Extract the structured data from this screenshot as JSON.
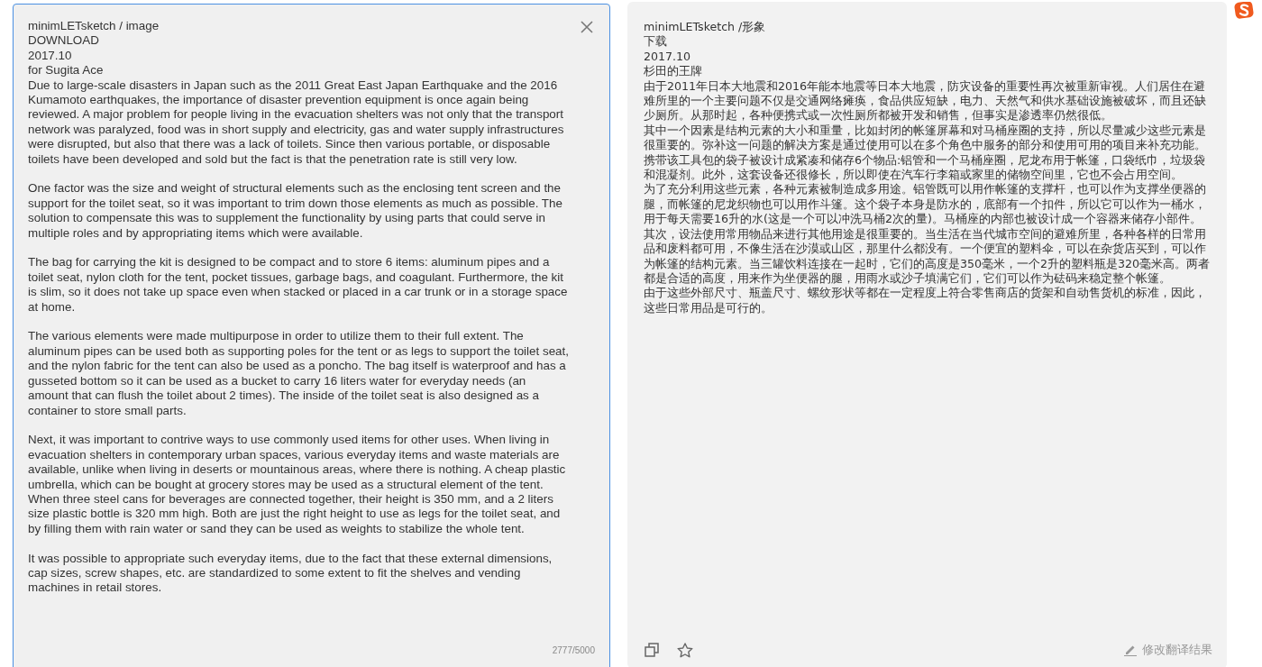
{
  "source": {
    "header": [
      "minimLETsketch / image",
      "DOWNLOAD",
      "2017.10",
      "for Sugita Ace"
    ],
    "paragraphs": [
      "Due to large-scale disasters in Japan such as the 2011 Great East Japan Earthquake and the 2016 Kumamoto earthquakes, the importance of disaster prevention equipment is once again being reviewed. A major problem for people living in the evacuation shelters was not only that the transport network was paralyzed, food was in short supply and electricity, gas and water supply infrastructures were disrupted, but also that there was a lack of toilets. Since then various portable, or disposable toilets have been developed and sold but the fact is that the penetration rate is still very low.",
      "One factor was the size and weight of structural elements such as the enclosing tent screen and the support for the toilet seat, so it was important to trim down those elements as much as possible. The solution to compensate this was to supplement the functionality by using parts that could serve in multiple roles and by appropriating items which were available.",
      "The bag for carrying the kit is designed to be compact and to store 6 items: aluminum pipes and a toilet seat, nylon cloth for the tent, pocket tissues, garbage bags, and coagulant. Furthermore, the kit is slim, so it does not take up space even when stacked or placed in a car trunk or in a storage space at home.",
      "The various elements were made multipurpose in order to utilize them to their full extent. The aluminum pipes can be used both as supporting poles for the tent or as legs to support the toilet seat, and the nylon fabric for the tent can also be used as a poncho. The bag itself is waterproof and has a gusseted bottom so it can be used as a bucket to carry 16 liters water for everyday needs (an amount that can flush the toilet about 2 times). The inside of the toilet seat is also designed as a container to store small parts.",
      "Next, it was important to contrive ways to use commonly used items for other uses. When living in evacuation shelters in contemporary urban spaces, various everyday items and waste materials are available, unlike when living in deserts or mountainous areas, where there is nothing. A cheap plastic umbrella, which can be bought at grocery stores may be used as a structural element of the tent. When three steel cans for beverages are connected together, their height is 350 mm, and a 2 liters size plastic bottle is 320 mm high. Both are just the right height to use as legs for the toilet seat, and by filling them with rain water or sand they can be used as weights to stabilize the whole tent.",
      "It was possible to appropriate such everyday items, due to the fact that these external dimensions, cap sizes, screw shapes, etc. are standardized to some extent to fit the shelves and vending machines in retail stores."
    ],
    "char_count": "2777/5000"
  },
  "translation": {
    "header": [
      "minimLETsketch /形象",
      "下载",
      "2017.10",
      "杉田的王牌"
    ],
    "paragraphs": [
      "由于2011年日本大地震和2016年能本地震等日本大地震，防灾设备的重要性再次被重新审视。人们居住在避难所里的一个主要问题不仅是交通网络瘫痪，食品供应短缺，电力、天然气和供水基础设施被破坏，而且还缺少厕所。从那时起，各种便携式或一次性厕所都被开发和销售，但事实是渗透率仍然很低。",
      "其中一个因素是结构元素的大小和重量，比如封闭的帐篷屏幕和对马桶座圈的支持，所以尽量减少这些元素是很重要的。弥补这一问题的解决方案是通过使用可以在多个角色中服务的部分和使用可用的项目来补充功能。",
      "携带该工具包的袋子被设计成紧凑和储存6个物品:铝管和一个马桶座圈，尼龙布用于帐篷，口袋纸巾，垃圾袋和混凝剂。此外，这套设备还很修长，所以即使在汽车行李箱或家里的储物空间里，它也不会占用空间。",
      "为了充分利用这些元素，各种元素被制造成多用途。铝管既可以用作帐篷的支撑杆，也可以作为支撑坐便器的腿，而帐篷的尼龙织物也可以用作斗篷。这个袋子本身是防水的，底部有一个扣件，所以它可以作为一桶水，用于每天需要16升的水(这是一个可以冲洗马桶2次的量)。马桶座的内部也被设计成一个容器来储存小部件。",
      "其次，设法使用常用物品来进行其他用途是很重要的。当生活在当代城市空间的避难所里，各种各样的日常用品和废料都可用，不像生活在沙漠或山区，那里什么都没有。一个便宜的塑料伞，可以在杂货店买到，可以作为帐篷的结构元素。当三罐饮料连接在一起时，它们的高度是350毫米，一个2升的塑料瓶是320毫米高。两者都是合适的高度，用来作为坐便器的腿，用雨水或沙子填满它们，它们可以作为砝码来稳定整个帐篷。",
      "由于这些外部尺寸、瓶盖尺寸、螺纹形状等都在一定程度上符合零售商店的货架和自动售货机的标准，因此，这些日常用品是可行的。"
    ],
    "edit_label": "修改翻译结果"
  }
}
